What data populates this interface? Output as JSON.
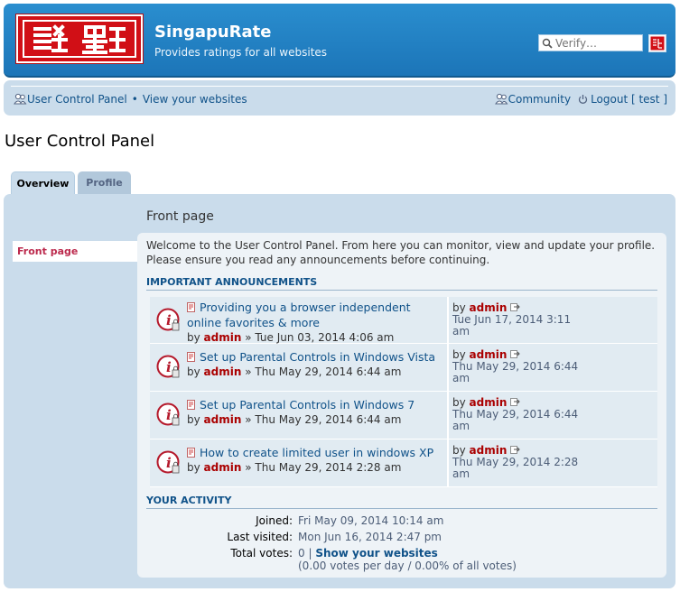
{
  "header": {
    "logo_alt": "SingapuRate logo",
    "site_name": "SingapuRate",
    "site_description": "Provides ratings for all websites",
    "search_placeholder": "Verify…"
  },
  "nav": {
    "ucp_label": "User Control Panel",
    "separator": "•",
    "view_websites_label": "View your websites",
    "community_label": "Community",
    "logout_label": "Logout [ test ]"
  },
  "page": {
    "title": "User Control Panel"
  },
  "tabs": [
    {
      "label": "Overview",
      "active": true
    },
    {
      "label": "Profile",
      "active": false
    }
  ],
  "sidebar": {
    "items": [
      {
        "label": "Front page",
        "active": true
      }
    ]
  },
  "main": {
    "heading": "Front page",
    "welcome_line1": "Welcome to the User Control Panel. From here you can monitor, view and update your profile.",
    "welcome_line2": "Please ensure you read any announcements before continuing.",
    "announcements_heading": "IMPORTANT ANNOUNCEMENTS",
    "announcements": [
      {
        "title_line1": "Providing you a browser independent",
        "title_line2": "online favorites & more",
        "by": "by",
        "author": "admin",
        "date": "» Tue Jun 03, 2014 4:06 am",
        "last_by": "by",
        "last_author": "admin",
        "last_date_line1": "Tue Jun 17, 2014 3:11",
        "last_date_line2": "am"
      },
      {
        "title_line1": "Set up Parental Controls in Windows Vista",
        "title_line2": "",
        "by": "by",
        "author": "admin",
        "date": "» Thu May 29, 2014 6:44 am",
        "last_by": "by",
        "last_author": "admin",
        "last_date_line1": "Thu May 29, 2014 6:44",
        "last_date_line2": "am"
      },
      {
        "title_line1": "Set up Parental Controls in Windows 7",
        "title_line2": "",
        "by": "by",
        "author": "admin",
        "date": "» Thu May 29, 2014 6:44 am",
        "last_by": "by",
        "last_author": "admin",
        "last_date_line1": "Thu May 29, 2014 6:44",
        "last_date_line2": "am"
      },
      {
        "title_line1": "How to create limited user in windows XP",
        "title_line2": "",
        "by": "by",
        "author": "admin",
        "date": "» Thu May 29, 2014 2:28 am",
        "last_by": "by",
        "last_author": "admin",
        "last_date_line1": "Thu May 29, 2014 2:28",
        "last_date_line2": "am"
      }
    ],
    "activity_heading": "YOUR ACTIVITY",
    "activity": {
      "joined_label": "Joined:",
      "joined_value": "Fri May 09, 2014 10:14 am",
      "last_visited_label": "Last visited:",
      "last_visited_value": "Mon Jun 16, 2014 2:47 pm",
      "total_votes_label": "Total votes:",
      "total_votes_value": "0 |",
      "show_websites_label": "Show your websites",
      "votes_detail": "(0.00 votes per day / 0.00% of all votes)"
    }
  },
  "colors": {
    "header_blue": "#1c75b8",
    "panel_bg": "#cadceb",
    "link_blue": "#105289",
    "author_red": "#aa0000",
    "active_tab_red": "#bc2a4d"
  }
}
